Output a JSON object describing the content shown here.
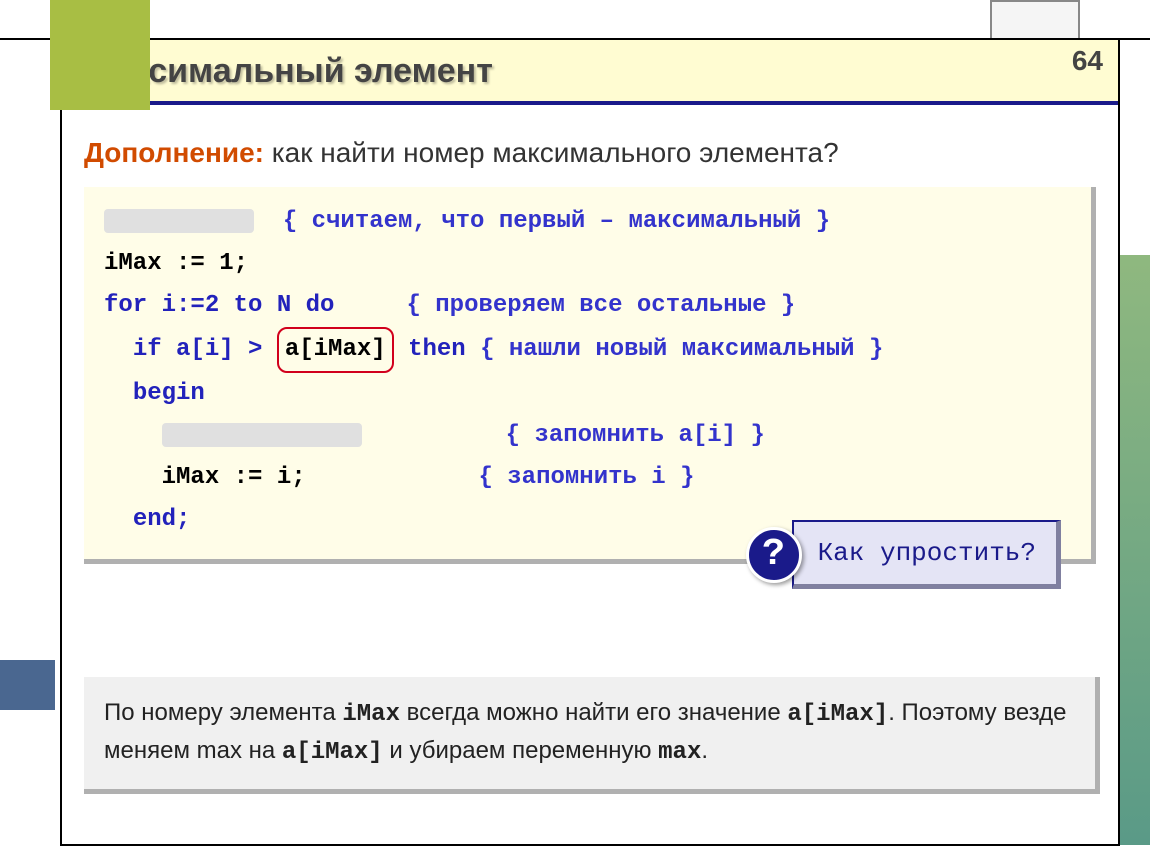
{
  "page_number": "64",
  "title": "Максимальный элемент",
  "subtitle_label": "Дополнение:",
  "subtitle_text": " как найти номер максимального элемента?",
  "code": {
    "c1": "{ считаем, что первый – максимальный }",
    "l2": "iMax := 1;",
    "l3a": "for i:=2 to N do",
    "c3": "{ проверяем все остальные }",
    "l4a": "if a[i] > ",
    "l4_circle": "a[iMax]",
    "l4b": " then ",
    "c4": "{ нашли новый максимальный }",
    "l5": "begin",
    "c6": "{ запомнить a[i] }",
    "l7": "iMax := i;",
    "c7": "{ запомнить i }",
    "l8": "end;"
  },
  "callout": {
    "icon": "?",
    "text": "Как упростить?"
  },
  "explain": {
    "t1": "По номеру элемента ",
    "m1": "iMax",
    "t2": " всегда можно найти его значение ",
    "m2": "a[iMax]",
    "t3": ". Поэтому везде меняем max на ",
    "m3": "a[iMax]",
    "t4": " и убираем переменную ",
    "m4": "max",
    "t5": "."
  }
}
